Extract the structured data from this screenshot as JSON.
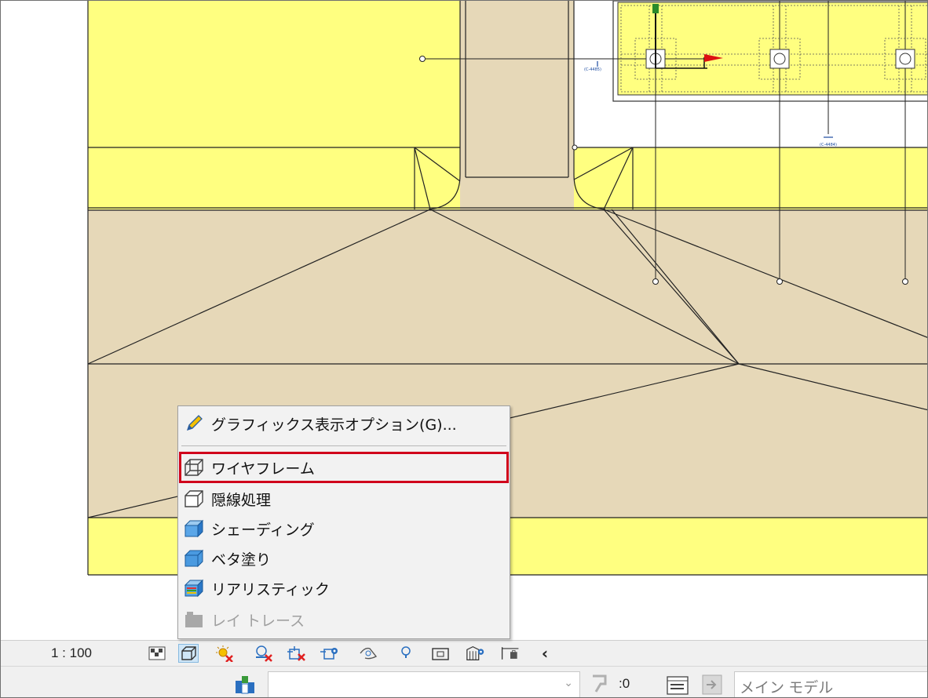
{
  "view_control_bar": {
    "scale": "1 : 100",
    "icons": [
      "detail-level-icon",
      "visual-style-icon",
      "sun-path-icon",
      "shadows-icon",
      "crop-view-icon",
      "show-crop-region-icon",
      "temporary-hide-icon",
      "reveal-hidden-icon",
      "analytical-model-icon",
      "highlight-displacement-icon",
      "constraints-icon",
      "collapse-chevron-icon"
    ],
    "collapse": "‹"
  },
  "visual_style_menu": {
    "graphics_options": "グラフィックス表示オプション(G)...",
    "items": [
      {
        "label": "ワイヤフレーム",
        "icon": "wireframe-icon",
        "highlighted": true
      },
      {
        "label": "隠線処理",
        "icon": "hidden-line-icon"
      },
      {
        "label": "シェーディング",
        "icon": "shaded-icon"
      },
      {
        "label": "ベタ塗り",
        "icon": "consistent-colors-icon"
      },
      {
        "label": "リアリスティック",
        "icon": "realistic-icon"
      },
      {
        "label": "レイ トレース",
        "icon": "ray-trace-icon",
        "disabled": true
      }
    ],
    "highlight_color": "#d0021b"
  },
  "status_bar": {
    "workset_value": "",
    "selection_count": ":0",
    "main_model": "メイン モデル"
  },
  "drawing": {
    "fill_yellow": "#ffff80",
    "fill_tan": "#e6d8b8",
    "tag_a": "(C-4485)",
    "tag_b": "(C-4484)"
  }
}
